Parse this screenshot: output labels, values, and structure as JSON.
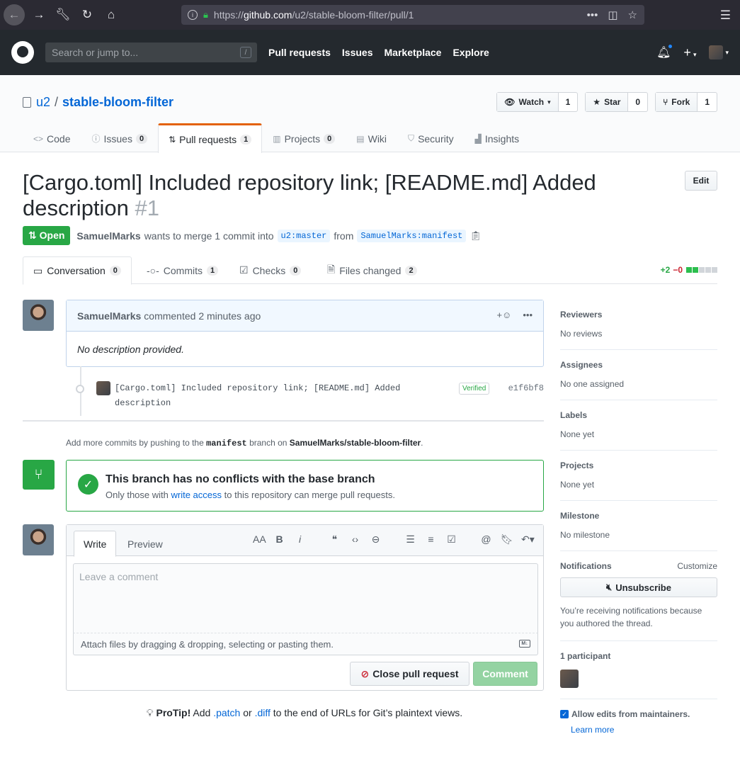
{
  "browser": {
    "url_domain": "github.com",
    "url_prefix": "https://",
    "url_path": "/u2/stable-bloom-filter/pull/1"
  },
  "header": {
    "search_placeholder": "Search or jump to...",
    "search_shortcut": "/",
    "nav": [
      "Pull requests",
      "Issues",
      "Marketplace",
      "Explore"
    ]
  },
  "repo": {
    "owner": "u2",
    "separator": "/",
    "name": "stable-bloom-filter",
    "watch_label": "Watch",
    "watch_count": "1",
    "star_label": "Star",
    "star_count": "0",
    "fork_label": "Fork",
    "fork_count": "1",
    "tabs": [
      {
        "label": "Code",
        "count": ""
      },
      {
        "label": "Issues",
        "count": "0"
      },
      {
        "label": "Pull requests",
        "count": "1"
      },
      {
        "label": "Projects",
        "count": "0"
      },
      {
        "label": "Wiki",
        "count": ""
      },
      {
        "label": "Security",
        "count": ""
      },
      {
        "label": "Insights",
        "count": ""
      }
    ]
  },
  "pr": {
    "title": "[Cargo.toml] Included repository link; [README.md] Added description",
    "number": "#1",
    "edit_label": "Edit",
    "state": "Open",
    "author": "SamuelMarks",
    "meta_text": "wants to merge 1 commit into",
    "base_branch": "u2:master",
    "from_text": "from",
    "head_branch": "SamuelMarks:manifest",
    "tabs": [
      {
        "label": "Conversation",
        "count": "0"
      },
      {
        "label": "Commits",
        "count": "1"
      },
      {
        "label": "Checks",
        "count": "0"
      },
      {
        "label": "Files changed",
        "count": "2"
      }
    ],
    "additions": "+2",
    "deletions": "−0"
  },
  "comment": {
    "author": "SamuelMarks",
    "action": "commented 2 minutes ago",
    "body": "No description provided."
  },
  "commit": {
    "message": "[Cargo.toml] Included repository link; [README.md] Added description",
    "verified": "Verified",
    "sha": "e1f6bf8"
  },
  "add_more": {
    "prefix": "Add more commits by pushing to the",
    "branch": "manifest",
    "middle": "branch on",
    "repo": "SamuelMarks/stable-bloom-filter",
    "suffix": "."
  },
  "merge": {
    "heading": "This branch has no conflicts with the base branch",
    "sub_prefix": "Only those with",
    "sub_link": "write access",
    "sub_suffix": "to this repository can merge pull requests."
  },
  "new_comment": {
    "write_tab": "Write",
    "preview_tab": "Preview",
    "placeholder": "Leave a comment",
    "attach_text": "Attach files by dragging & dropping, selecting or pasting them.",
    "close_label": "Close pull request",
    "comment_label": "Comment"
  },
  "protip": {
    "label": "ProTip!",
    "t1": "Add",
    "patch": ".patch",
    "t2": "or",
    "diff": ".diff",
    "t3": "to the end of URLs for Git’s plaintext views."
  },
  "sidebar": {
    "reviewers_label": "Reviewers",
    "reviewers_value": "No reviews",
    "assignees_label": "Assignees",
    "assignees_value": "No one assigned",
    "labels_label": "Labels",
    "labels_value": "None yet",
    "projects_label": "Projects",
    "projects_value": "None yet",
    "milestone_label": "Milestone",
    "milestone_value": "No milestone",
    "notifications_label": "Notifications",
    "customize": "Customize",
    "unsubscribe": "Unsubscribe",
    "notif_reason": "You’re receiving notifications because you authored the thread.",
    "participants": "1 participant",
    "allow_edits": "Allow edits from maintainers.",
    "learn_more": "Learn more"
  },
  "colors": {
    "open_green": "#28a745",
    "link_blue": "#0366d6",
    "selected_tab_accent": "#e36209"
  }
}
